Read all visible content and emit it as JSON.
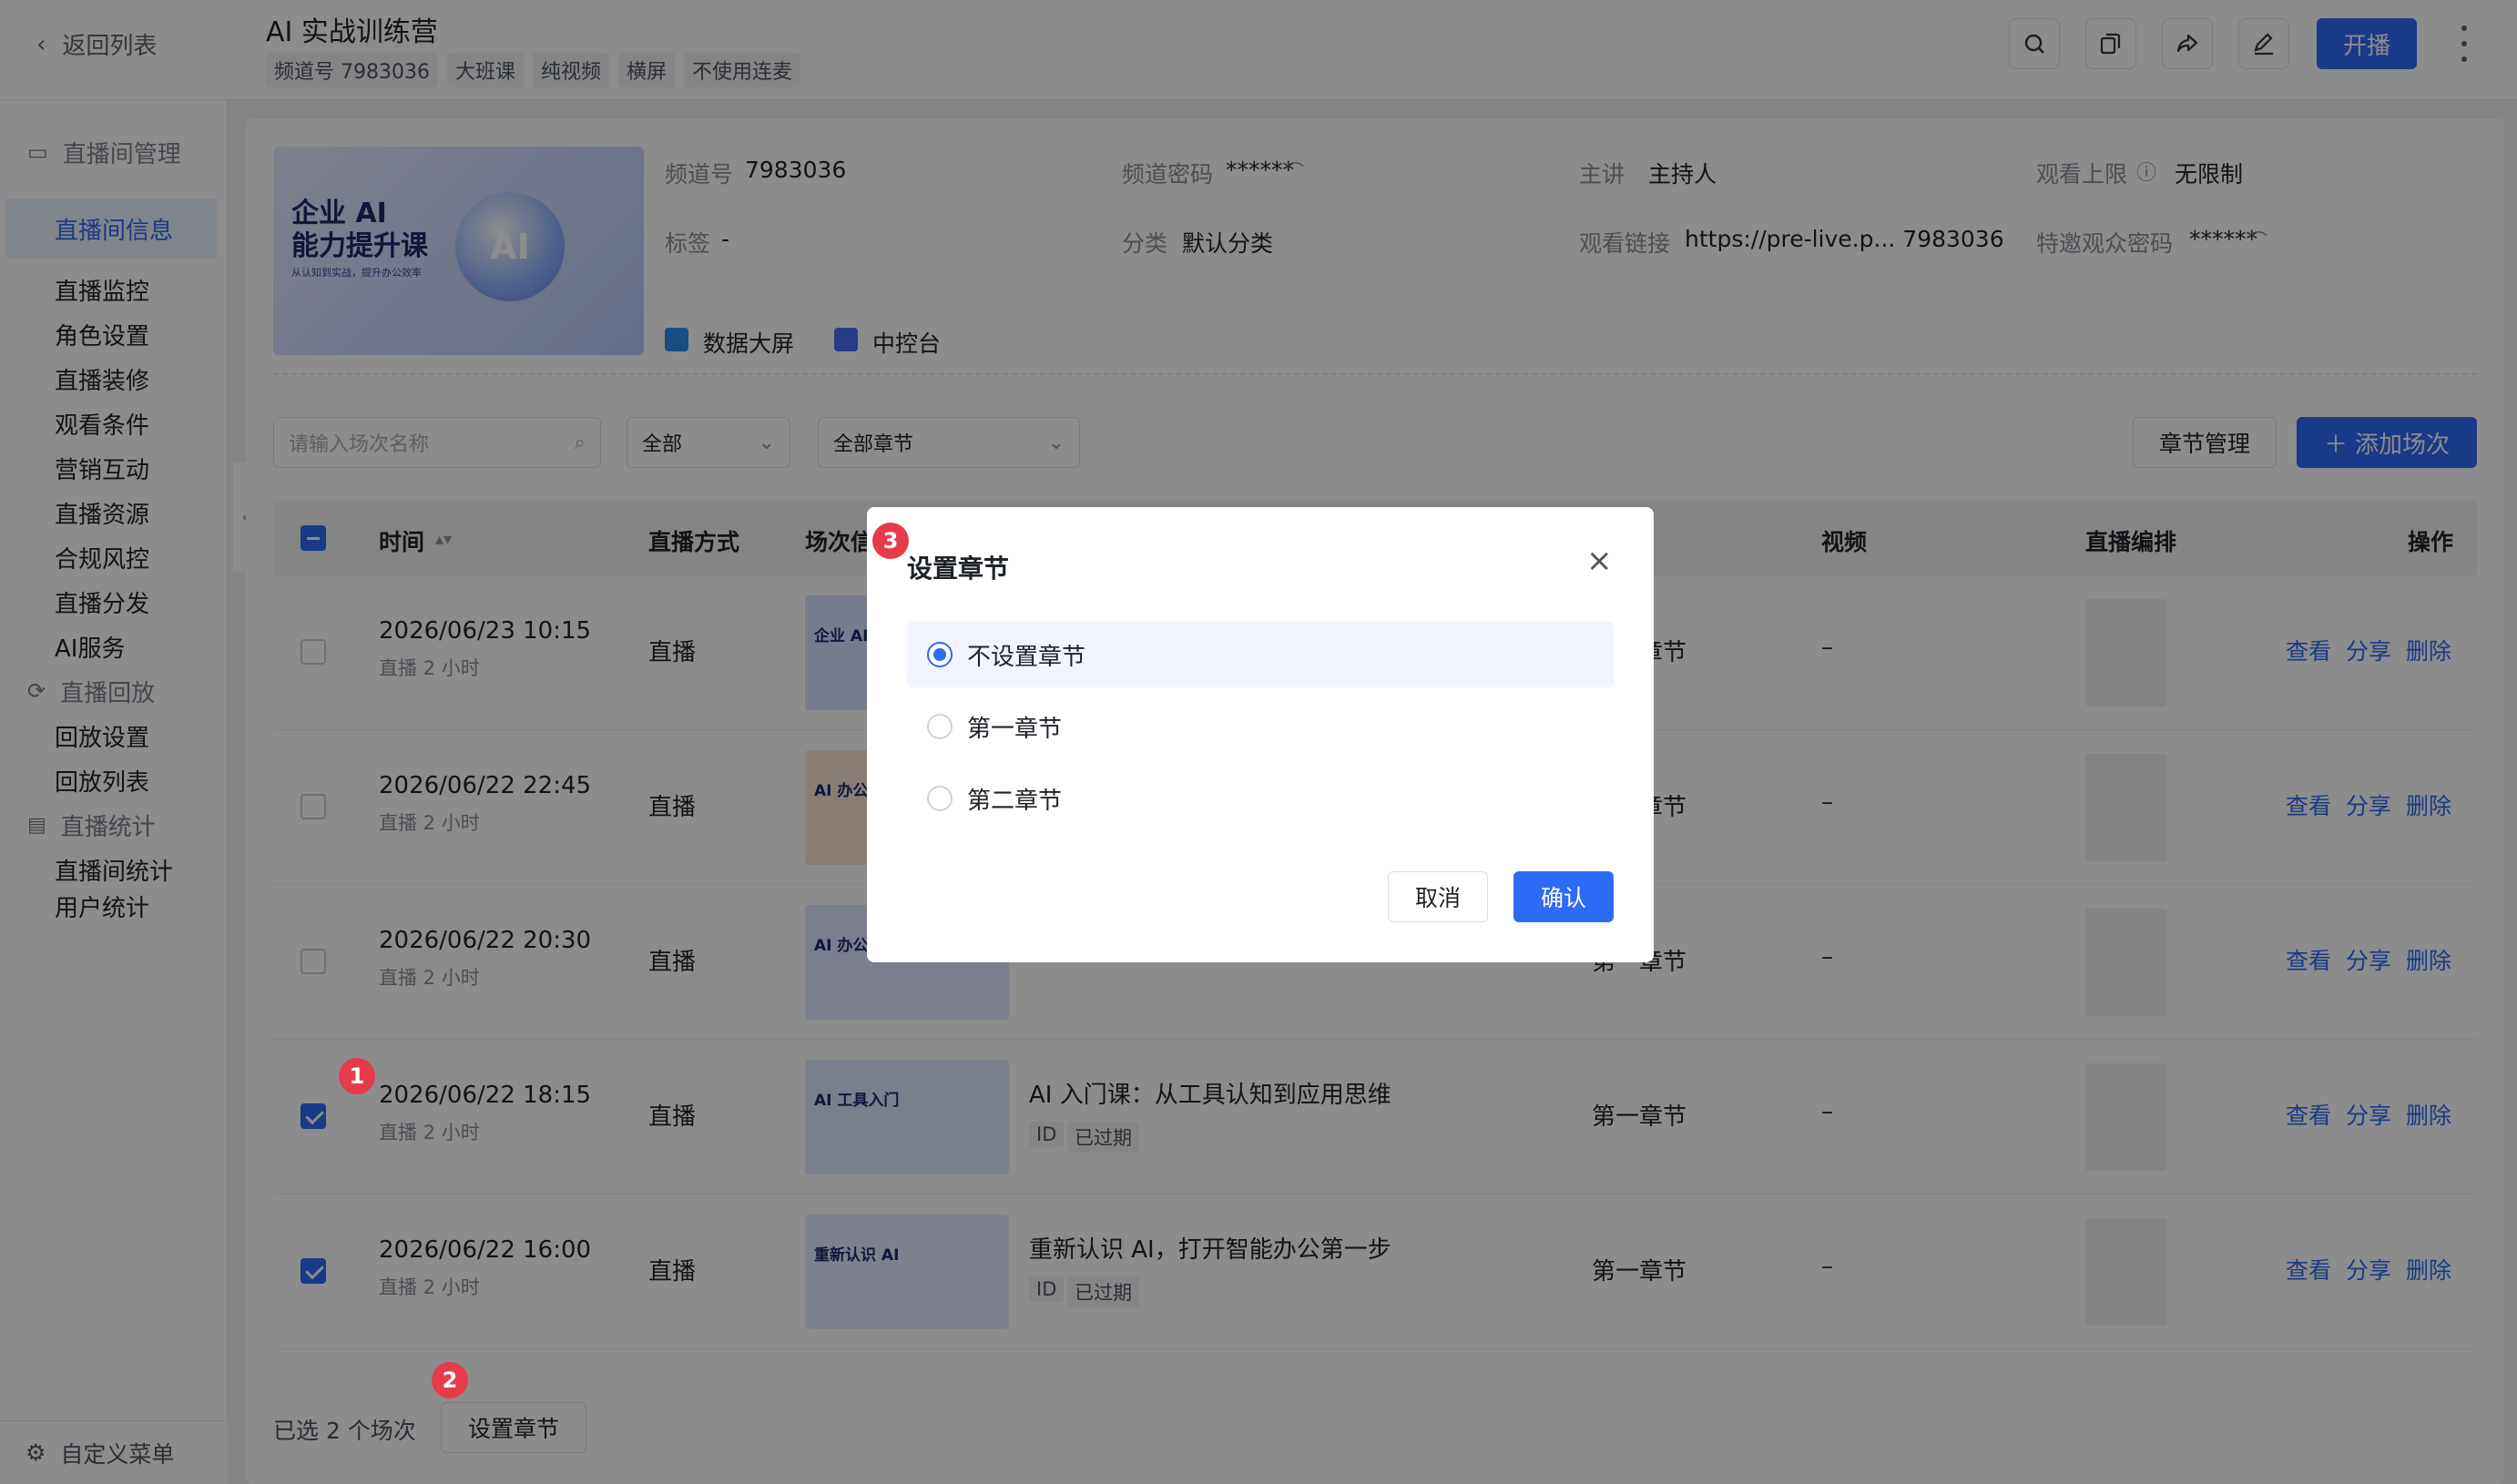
{
  "header": {
    "back_label": "返回列表",
    "title": "AI 实战训练营",
    "tags": [
      "频道号 7983036",
      "大班课",
      "纯视频",
      "横屏",
      "不使用连麦"
    ],
    "live_button": "开播"
  },
  "sidebar": {
    "groups": [
      {
        "label": "直播间管理",
        "icon": "monitor-play-icon"
      },
      {
        "label": "直播回放",
        "icon": "replay-icon"
      },
      {
        "label": "直播统计",
        "icon": "chart-icon"
      }
    ],
    "items": [
      "直播间信息",
      "直播监控",
      "角色设置",
      "直播装修",
      "观看条件",
      "营销互动",
      "直播资源",
      "合规风控",
      "直播分发",
      "AI服务",
      "回放设置",
      "回放列表",
      "直播间统计",
      "用户统计"
    ],
    "bottom_label": "自定义菜单"
  },
  "info": {
    "banner_title": "企业 AI\n能力提升课",
    "banner_sub": "从认知到实战，提升办公效率",
    "banner_badge": "AI",
    "channel_label": "频道号",
    "channel_value": "7983036",
    "password_label": "频道密码",
    "password_value": "******",
    "host_label": "主讲",
    "host_value": "主持人",
    "limit_label": "观看上限",
    "limit_value": "无限制",
    "tag_label": "标签",
    "tag_value": "-",
    "category_label": "分类",
    "category_value": "默认分类",
    "link_label": "观看链接",
    "link_value": "https://pre-live.p... 7983036",
    "invite_label": "特邀观众密码",
    "invite_value": "******",
    "dashboard_label": "数据大屏",
    "console_label": "中控台"
  },
  "filters": {
    "search_placeholder": "请输入场次名称",
    "type_value": "全部",
    "chapter_value": "全部章节",
    "chapter_manage": "章节管理",
    "add_session": "添加场次"
  },
  "table": {
    "headers": [
      "时间",
      "直播方式",
      "场次信息",
      "章节",
      "视频",
      "直播编排",
      "操作"
    ],
    "rows": [
      {
        "time": "2026/06/23 10:15",
        "duration": "直播 2 小时",
        "mode": "直播",
        "thumb": "企业 AI 能力提升",
        "name": "",
        "chapter": "第一章节",
        "video": "–",
        "checked": false,
        "thumb_color": "#d9e2ff"
      },
      {
        "time": "2026/06/22 22:45",
        "duration": "直播 2 小时",
        "mode": "直播",
        "thumb": "AI 办公实",
        "name": "",
        "chapter": "第一章节",
        "video": "–",
        "checked": false,
        "thumb_color": "#f8e6d8"
      },
      {
        "time": "2026/06/22 20:30",
        "duration": "直播 2 小时",
        "mode": "直播",
        "thumb": "AI 办公",
        "name": "",
        "chapter": "第一章节",
        "video": "–",
        "checked": false,
        "thumb_color": "#e0e6ff"
      },
      {
        "time": "2026/06/22 18:15",
        "duration": "直播 2 小时",
        "mode": "直播",
        "thumb": "AI 工具入门",
        "name": "AI 入门课：从工具认知到应用思维",
        "chapter": "第一章节",
        "video": "–",
        "checked": true,
        "thumb_color": "#dceaff"
      },
      {
        "time": "2026/06/22 16:00",
        "duration": "直播 2 小时",
        "mode": "直播",
        "thumb": "重新认识 AI",
        "name": "重新认识 AI，打开智能办公第一步",
        "chapter": "第一章节",
        "video": "–",
        "checked": true,
        "thumb_color": "#e4ecff"
      }
    ],
    "id_label": "ID",
    "expired_label": "已过期",
    "ops": [
      "查看",
      "分享",
      "删除"
    ]
  },
  "footer": {
    "selected_text": "已选 2 个场次",
    "set_chapter": "设置章节"
  },
  "markers": [
    "1",
    "2",
    "3"
  ],
  "modal": {
    "title": "设置章节",
    "options": [
      "不设置章节",
      "第一章节",
      "第二章节"
    ],
    "selected_index": 0,
    "cancel": "取消",
    "confirm": "确认"
  }
}
